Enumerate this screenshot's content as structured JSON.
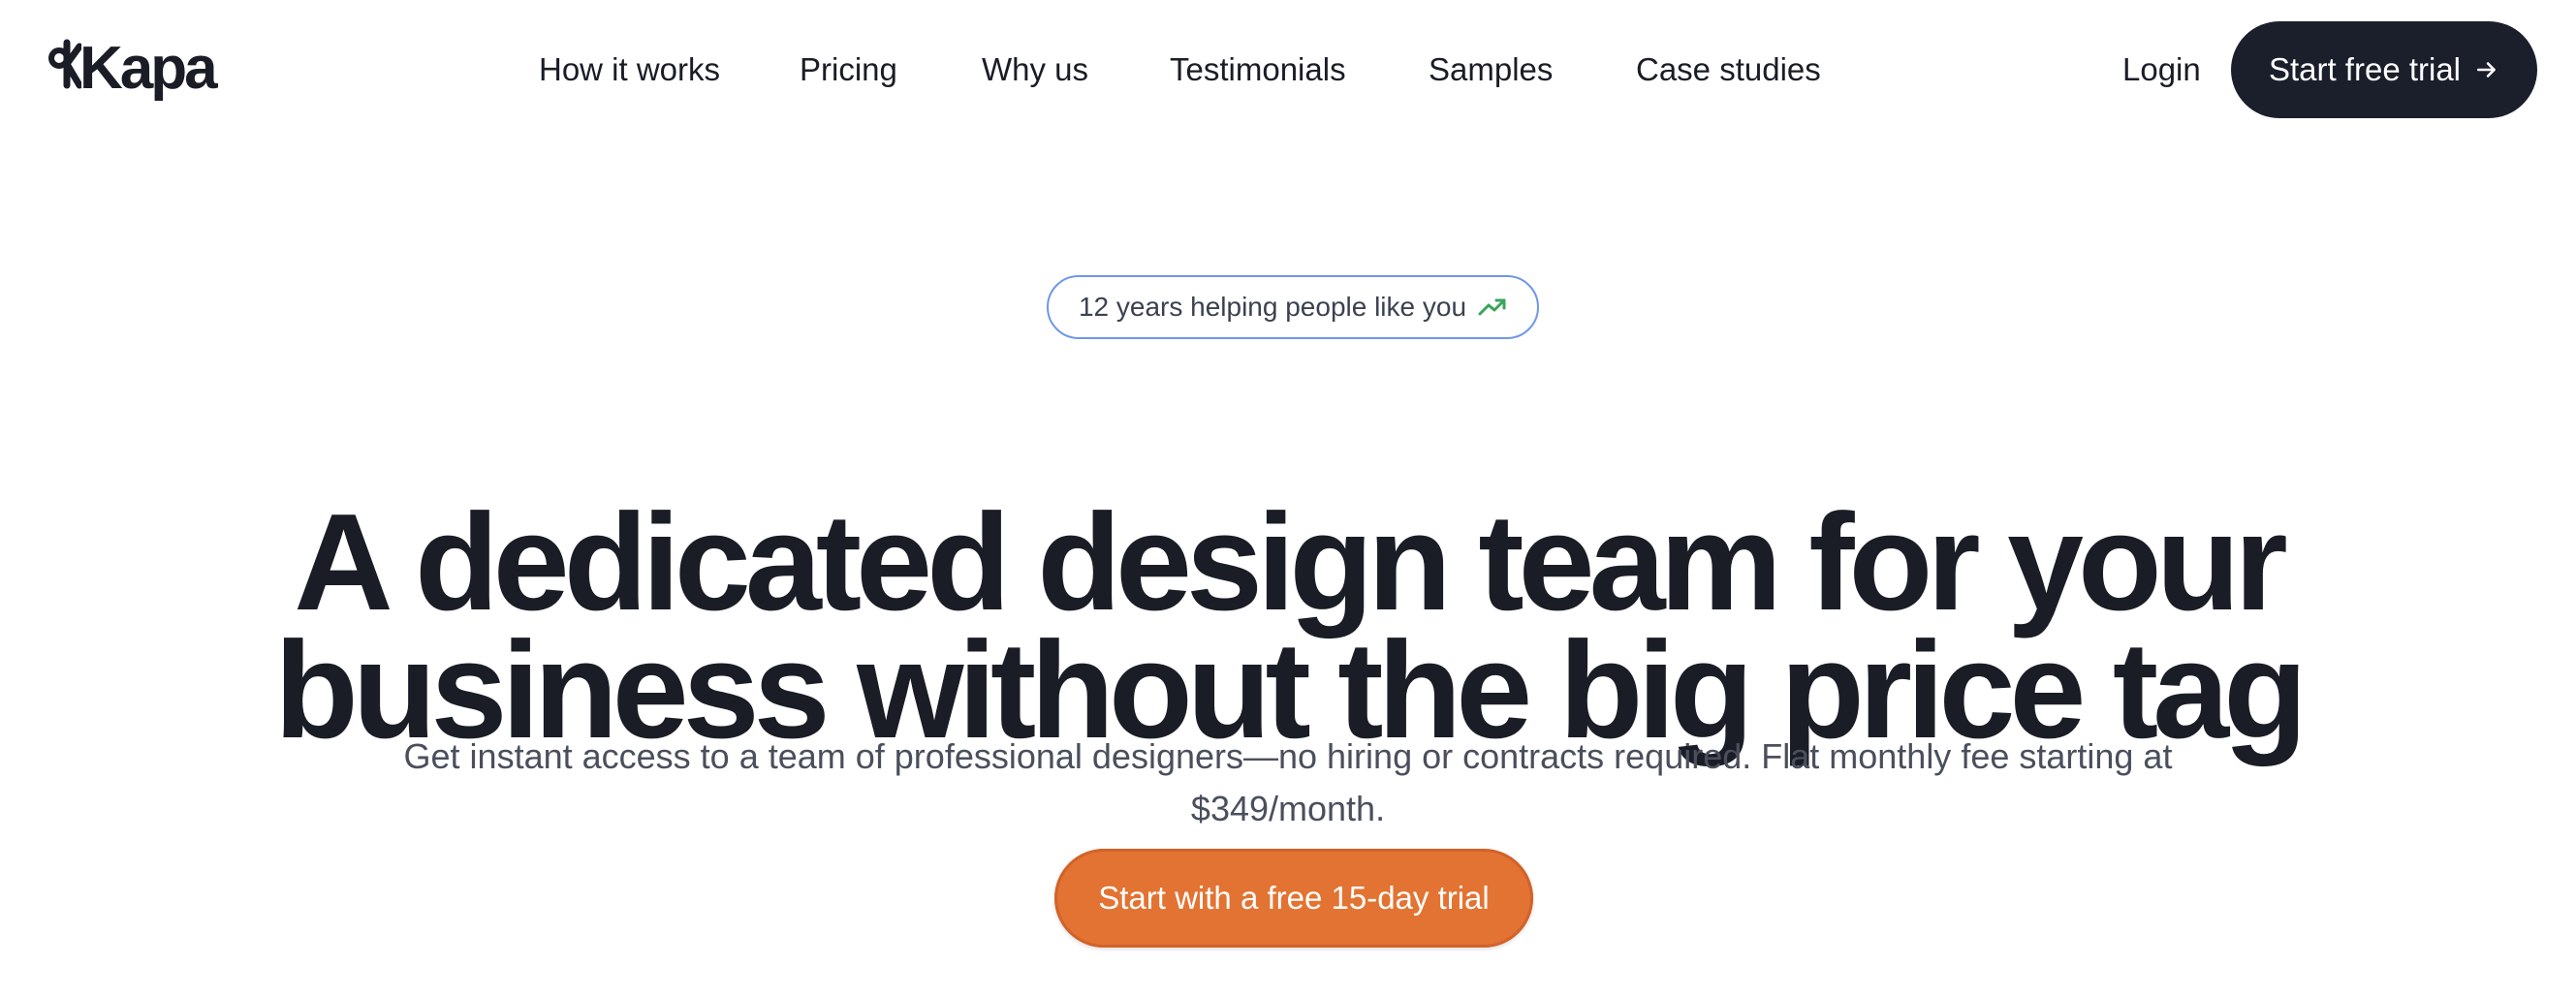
{
  "brand": {
    "name": "Kapa"
  },
  "nav": {
    "items": [
      {
        "label": "How it works"
      },
      {
        "label": "Pricing"
      },
      {
        "label": "Why us"
      },
      {
        "label": "Testimonials"
      },
      {
        "label": "Samples"
      },
      {
        "label": "Case studies"
      }
    ],
    "login_label": "Login",
    "cta_label": "Start free trial"
  },
  "hero": {
    "badge_text": "12 years helping people like you",
    "headline_line1": "A dedicated design team for your",
    "headline_line2": "business without the big price tag",
    "subtext_line1": "Get instant access to a team of professional designers—no hiring or contracts required. Flat monthly fee starting at",
    "subtext_line2": "$349/month.",
    "cta_label": "Start with a free 15-day trial"
  },
  "colors": {
    "text_dark": "#1a1d26",
    "button_dark": "#1b1f2b",
    "accent_orange": "#e37332",
    "badge_border": "#6f97e8",
    "trend_green": "#3aa55a",
    "subtext_gray": "#4a4f5c"
  },
  "icons": {
    "logo_mark": "kapa-logo-icon",
    "cta_arrow": "arrow-right-icon",
    "badge_trend": "trending-up-icon"
  }
}
